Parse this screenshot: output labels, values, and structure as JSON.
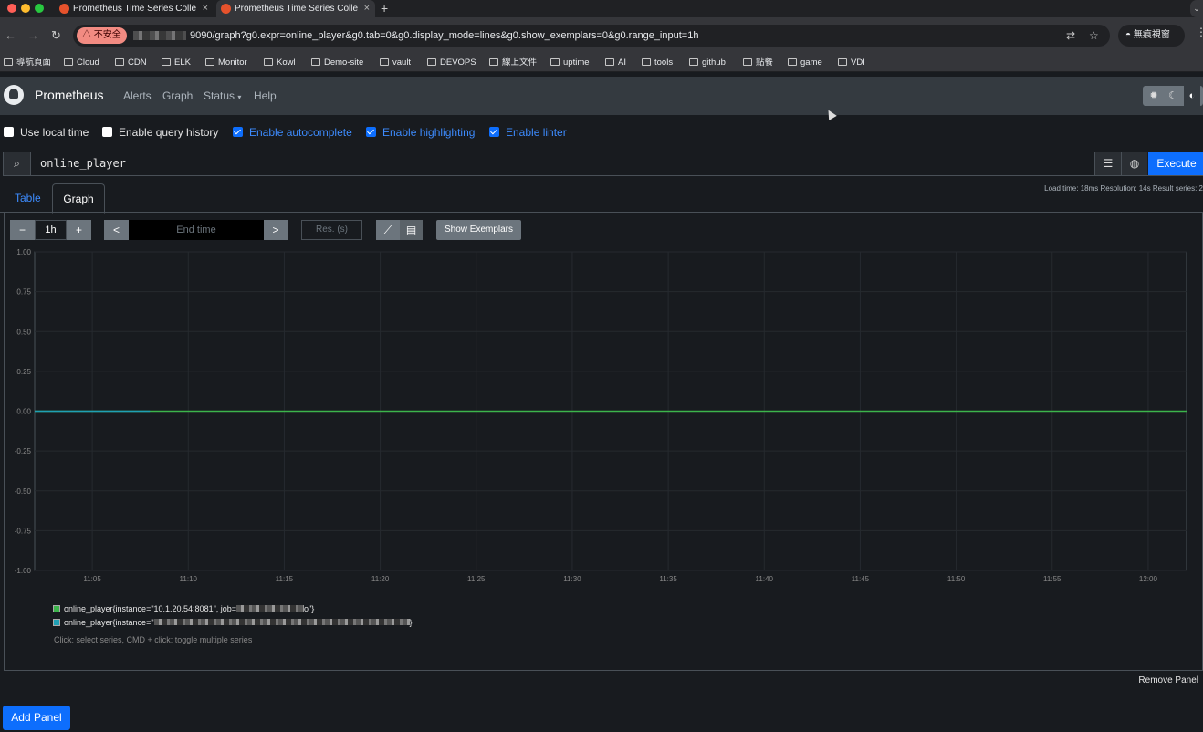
{
  "browser": {
    "tabs": [
      {
        "title": "Prometheus Time Series Colle",
        "close": "×"
      },
      {
        "title": "Prometheus Time Series Colle",
        "close": "×"
      }
    ],
    "new_tab": "+",
    "insecure_label": "△ 不安全",
    "url": "9090/graph?g0.expr=online_player&g0.tab=0&g0.display_mode=lines&g0.show_exemplars=0&g0.range_input=1h",
    "incognito_label": "無痕視窗",
    "bookmarks": [
      "導航頁面",
      "Cloud",
      "CDN",
      "ELK",
      "Monitor",
      "Kowl",
      "Demo-site",
      "vault",
      "DEVOPS",
      "線上文件",
      "uptime",
      "AI",
      "tools",
      "github",
      "點餐",
      "game",
      "VDI"
    ]
  },
  "navbar": {
    "brand": "Prometheus",
    "links": [
      "Alerts",
      "Graph",
      "Status",
      "Help"
    ],
    "status_caret": "▾"
  },
  "options": [
    {
      "label": "Use local time",
      "checked": false
    },
    {
      "label": "Enable query history",
      "checked": false
    },
    {
      "label": "Enable autocomplete",
      "checked": true
    },
    {
      "label": "Enable highlighting",
      "checked": true
    },
    {
      "label": "Enable linter",
      "checked": true
    }
  ],
  "query": {
    "expr": "online_player",
    "execute_label": "Execute"
  },
  "tabs": {
    "table": "Table",
    "graph": "Graph"
  },
  "stats": "Load time: 18ms   Resolution: 14s   Result series: 2",
  "controls": {
    "minus": "−",
    "range": "1h",
    "plus": "+",
    "prev": "<",
    "end_time_placeholder": "End time",
    "next": ">",
    "res_placeholder": "Res. (s)",
    "show_exemplars": "Show Exemplars"
  },
  "chart_data": {
    "type": "line",
    "x_ticks": [
      "11:05",
      "11:10",
      "11:15",
      "11:20",
      "11:25",
      "11:30",
      "11:35",
      "11:40",
      "11:45",
      "11:50",
      "11:55",
      "12:00"
    ],
    "y_ticks": [
      "1.00",
      "0.75",
      "0.50",
      "0.25",
      "0.00",
      "-0.25",
      "-0.50",
      "-0.75",
      "-1.00"
    ],
    "ylim": [
      -1,
      1
    ],
    "series": [
      {
        "name": "online_player{instance=\"10.1.20.54:8081\", job=\"...o\"}",
        "color": "#3cb44b",
        "x_range": [
          "11:02",
          "12:02"
        ],
        "values": [
          0,
          0
        ]
      },
      {
        "name": "online_player{instance=\"...\"}",
        "color": "#1f9fb4",
        "x_range": [
          "11:02",
          "11:08"
        ],
        "values": [
          0,
          0
        ]
      }
    ]
  },
  "legend": {
    "series1_prefix": "online_player{instance=\"10.1.20.54:8081\", job=",
    "series1_suffix": "o\"}",
    "series2_prefix": "online_player{instance=\"",
    "series2_suffix": "}",
    "hint": "Click: select series, CMD + click: toggle multiple series"
  },
  "remove_panel": "Remove Panel",
  "add_panel": "Add Panel",
  "colors": {
    "accent": "#0d6efd",
    "background": "#181b1f",
    "navbar": "#343a40"
  }
}
